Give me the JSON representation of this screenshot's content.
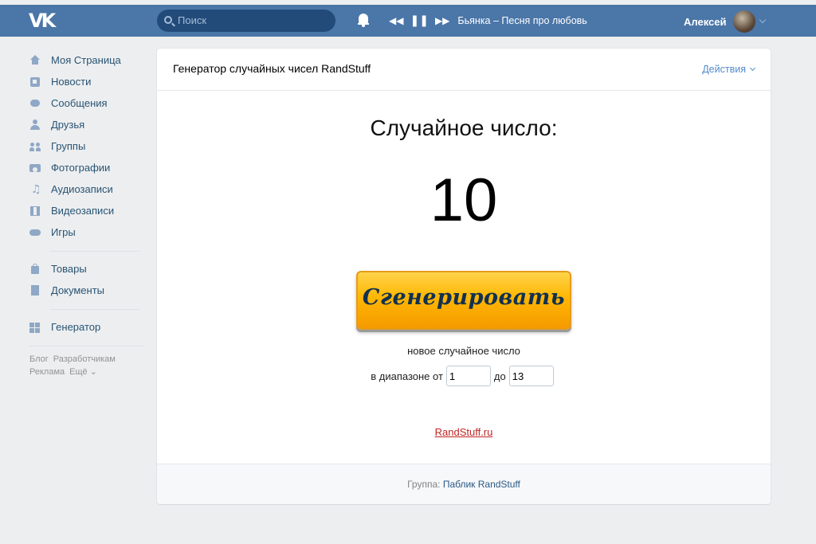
{
  "header": {
    "logo": "VK",
    "search_placeholder": "Поиск",
    "player": {
      "prev": "◀◀",
      "pause": "❚❚",
      "next": "▶▶",
      "track": "Бьянка – Песня про любовь"
    },
    "user_name": "Алексей"
  },
  "sidebar": {
    "items": [
      {
        "label": "Моя Страница",
        "icon": "home-icon"
      },
      {
        "label": "Новости",
        "icon": "news-icon"
      },
      {
        "label": "Сообщения",
        "icon": "messages-icon"
      },
      {
        "label": "Друзья",
        "icon": "friends-icon"
      },
      {
        "label": "Группы",
        "icon": "groups-icon"
      },
      {
        "label": "Фотографии",
        "icon": "camera-icon"
      },
      {
        "label": "Аудиозаписи",
        "icon": "music-note-icon"
      },
      {
        "label": "Видеозаписи",
        "icon": "film-icon"
      },
      {
        "label": "Игры",
        "icon": "gamepad-icon"
      }
    ],
    "items2": [
      {
        "label": "Товары",
        "icon": "bag-icon"
      },
      {
        "label": "Документы",
        "icon": "document-icon"
      }
    ],
    "items3": [
      {
        "label": "Генератор",
        "icon": "apps-grid-icon"
      }
    ],
    "footer": {
      "blog": "Блог",
      "developers": "Разработчикам",
      "ads": "Реклама",
      "more": "Ещё ⌄"
    }
  },
  "main": {
    "app_title": "Генератор случайных чисел RandStuff",
    "actions_label": "Действия",
    "heading": "Случайное число:",
    "number": "10",
    "generate_label": "Сгенерировать",
    "subtitle": "новое случайное число",
    "range_from_label": "в диапазоне от",
    "range_from_value": "1",
    "range_to_label": "до",
    "range_to_value": "13",
    "site_link": "RandStuff.ru",
    "footer_prefix": "Группа: ",
    "footer_group": "Паблик RandStuff"
  },
  "colors": {
    "header_bg": "#4a76a8",
    "page_bg": "#edeef0",
    "link_blue": "#2a5885",
    "button_orange": "#ffb703",
    "link_red": "#c12424"
  }
}
